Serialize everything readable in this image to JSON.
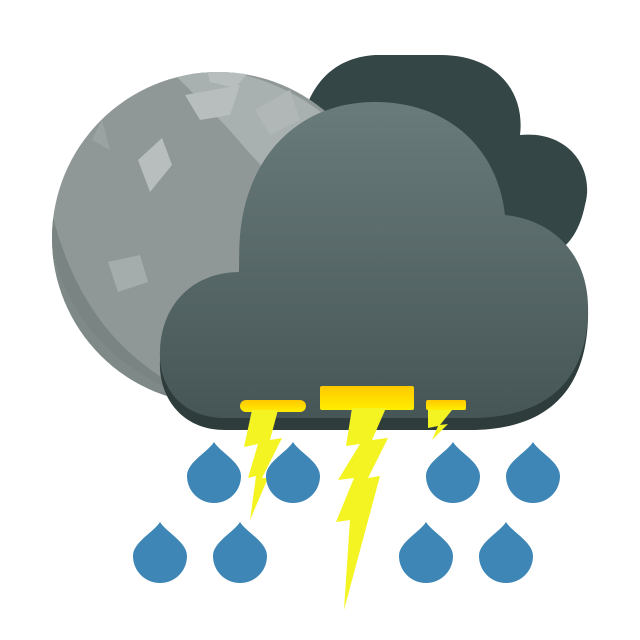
{
  "icon": {
    "name": "night-thunderstorm-rain-weather-icon",
    "parts": [
      "moon-icon",
      "back-cloud-icon",
      "front-cloud-icon",
      "lightning-bolt-icon",
      "raindrop-icon"
    ],
    "colors": {
      "moon_light": "#9ea6a5",
      "moon_dark": "#7f8988",
      "moon_crater": "#b7bebd",
      "back_cloud": "#344646",
      "front_cloud_top": "#6a7b7b",
      "front_cloud_bottom": "#465656",
      "cloud_shadow": "#2f3c3c",
      "lightning": "#f4f422",
      "lightning_cap_top": "#ffc800",
      "lightning_cap_bottom": "#ffee00",
      "raindrop": "#3d86b6"
    }
  }
}
